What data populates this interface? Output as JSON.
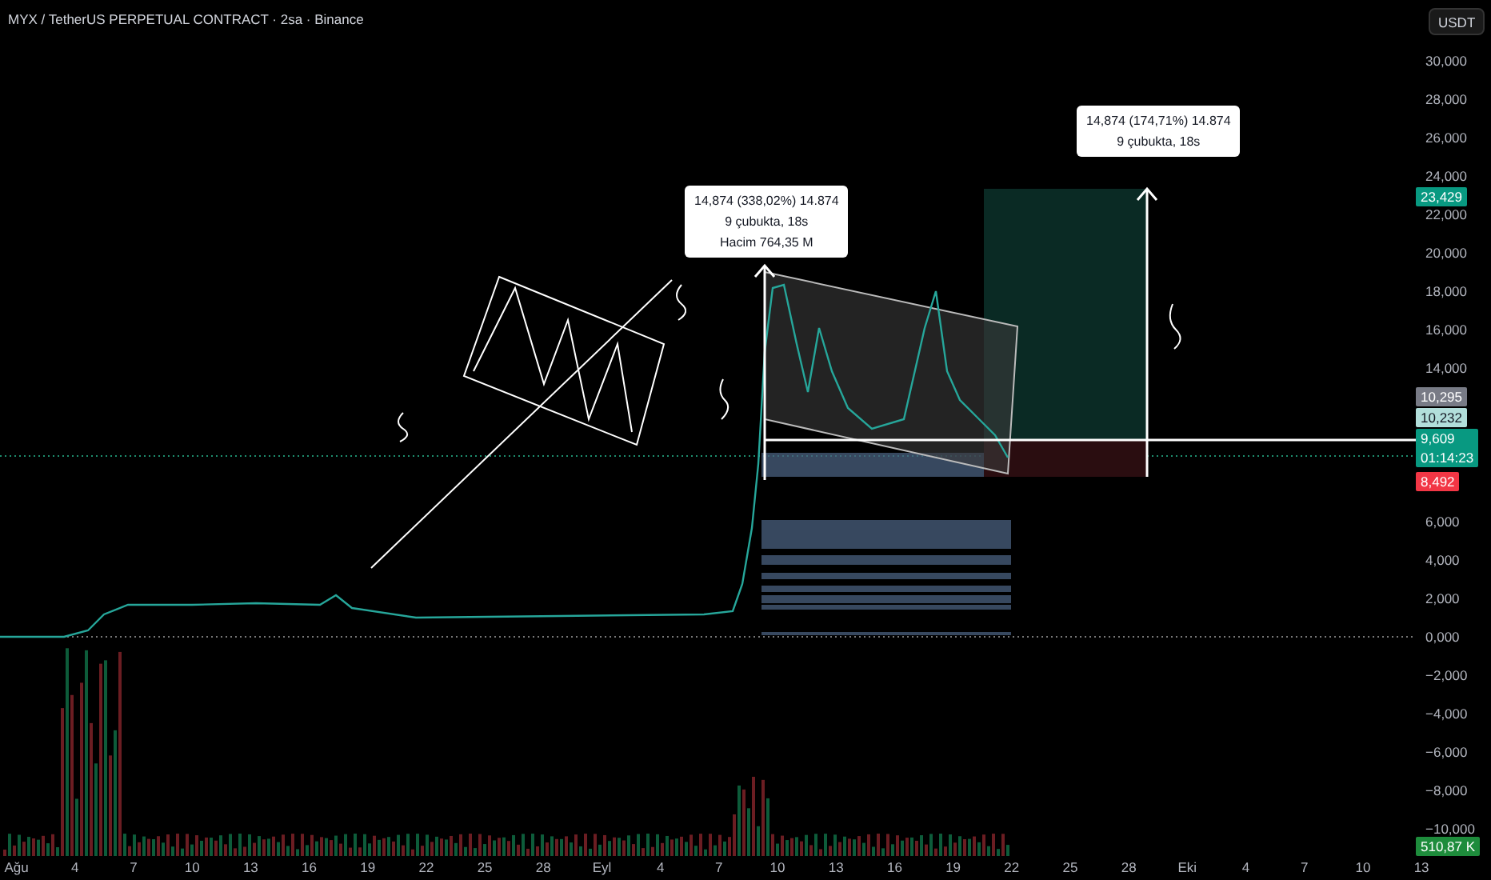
{
  "header": {
    "title": "MYX / TetherUS PERPETUAL CONTRACT · 2sa · Binance",
    "currency_button": "USDT"
  },
  "measurements": [
    {
      "lines": [
        "14,874 (338,02%) 14.874",
        "9 çubukta, 18s",
        "Hacim 764,35 M"
      ]
    },
    {
      "lines": [
        "14,874 (174,71%) 14.874",
        "9 çubukta, 18s"
      ]
    }
  ],
  "price_axis": {
    "items": [
      {
        "kind": "tick",
        "text": "30,000"
      },
      {
        "kind": "tick",
        "text": "28,000"
      },
      {
        "kind": "tick",
        "text": "26,000"
      },
      {
        "kind": "tick",
        "text": "24,000"
      },
      {
        "kind": "target",
        "color": "#089981",
        "lines": [
          "23,429"
        ]
      },
      {
        "kind": "tick",
        "text": "22,000"
      },
      {
        "kind": "tick",
        "text": "20,000"
      },
      {
        "kind": "tick",
        "text": "18,000"
      },
      {
        "kind": "tick",
        "text": "16,000"
      },
      {
        "kind": "tick",
        "text": "14,000"
      },
      {
        "kind": "high",
        "color": "#787b86",
        "lines": [
          "10,295"
        ]
      },
      {
        "kind": "close",
        "color": "#b2dfdb",
        "lines": [
          "10,232"
        ]
      },
      {
        "kind": "last",
        "color": "#089981",
        "lines": [
          "9,609",
          "01:14:23"
        ]
      },
      {
        "kind": "low",
        "color": "#f23645",
        "lines": [
          "8,492"
        ]
      },
      {
        "kind": "tick",
        "text": "6,000"
      },
      {
        "kind": "tick",
        "text": "4,000"
      },
      {
        "kind": "tick",
        "text": "2,000"
      },
      {
        "kind": "tick",
        "text": "0,000"
      },
      {
        "kind": "tick",
        "text": "−2,000"
      },
      {
        "kind": "tick",
        "text": "−4,000"
      },
      {
        "kind": "tick",
        "text": "−6,000"
      },
      {
        "kind": "tick",
        "text": "−8,000"
      },
      {
        "kind": "tick",
        "text": "−10,000"
      },
      {
        "kind": "volume",
        "color": "#1e8c3c",
        "lines": [
          "510,87 K"
        ]
      }
    ]
  },
  "time_axis": {
    "labels": [
      "Ağu",
      "4",
      "7",
      "10",
      "13",
      "16",
      "19",
      "22",
      "25",
      "28",
      "Eyl",
      "4",
      "7",
      "10",
      "13",
      "16",
      "19",
      "22",
      "25",
      "28",
      "Eki",
      "4",
      "7",
      "10",
      "13"
    ]
  }
}
